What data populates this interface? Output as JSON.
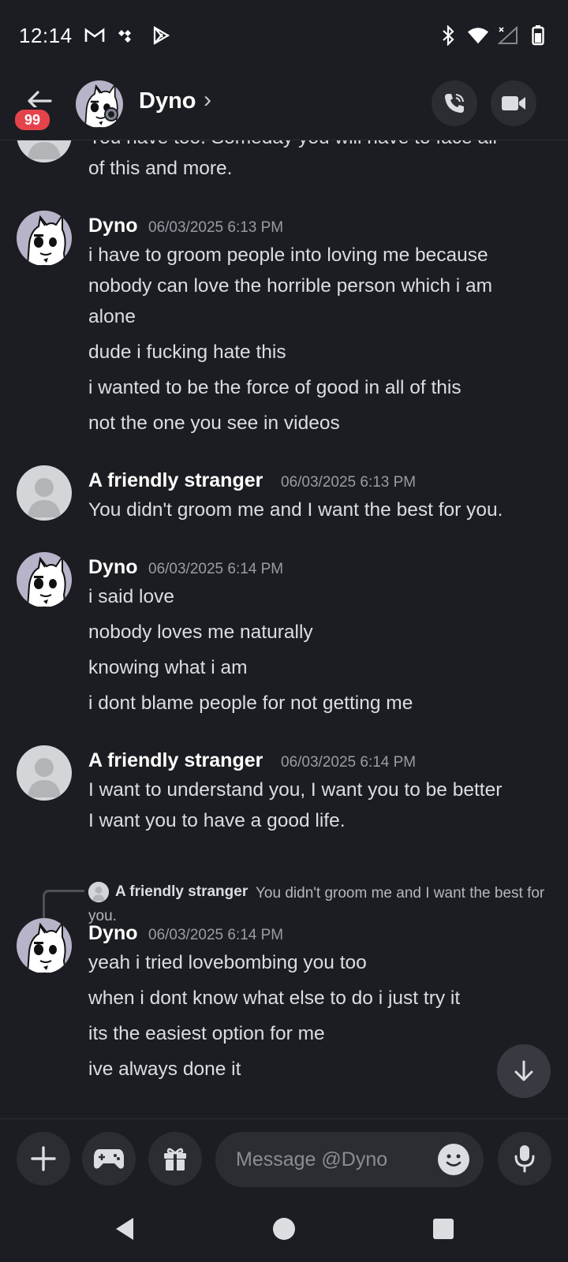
{
  "status_bar": {
    "time": "12:14"
  },
  "header": {
    "contact_name": "Dyno",
    "unread_count": "99"
  },
  "messages": [
    {
      "lines": [
        "You have too. Someday you will have to face all",
        "of this and more."
      ]
    },
    {
      "author": "Dyno",
      "timestamp": "06/03/2025 6:13 PM",
      "lines": [
        "i have to groom people into loving me because",
        "nobody can love the horrible person which i am",
        "alone",
        "dude i fucking hate this",
        "i wanted to be the force of good in all of this",
        "not the one you see in videos"
      ]
    },
    {
      "author": "A friendly stranger",
      "timestamp": "06/03/2025 6:13 PM",
      "lines": [
        "You didn't groom me and I want the best for you."
      ]
    },
    {
      "author": "Dyno",
      "timestamp": "06/03/2025 6:14 PM",
      "lines": [
        "i said love",
        "nobody loves me naturally",
        "knowing what i am",
        "i dont blame people for not getting me"
      ]
    },
    {
      "author": "A friendly stranger",
      "timestamp": "06/03/2025 6:14 PM",
      "lines": [
        "I want to understand you, I want you to be better",
        "I want you to have a good life."
      ]
    },
    {
      "author": "Dyno",
      "timestamp": "06/03/2025 6:14 PM",
      "reply": {
        "author": "A friendly stranger",
        "text": "You didn't groom me and I want the best for you."
      },
      "lines": [
        "yeah i tried lovebombing you too",
        "when i dont know what else to do i just try it",
        "its the easiest option for me",
        "ive always done it"
      ]
    }
  ],
  "composer": {
    "placeholder": "Message @Dyno"
  },
  "icons": {
    "back": "arrow-left-icon",
    "call": "phone-icon",
    "video": "video-camera-icon",
    "add": "plus-icon",
    "games": "gamepad-icon",
    "gift": "gift-icon",
    "emoji": "smiley-icon",
    "mic": "microphone-icon",
    "scroll": "arrow-down-icon"
  },
  "colors": {
    "background": "#1c1d22",
    "badge": "#e5434b",
    "muted": "#9a9ca4"
  }
}
